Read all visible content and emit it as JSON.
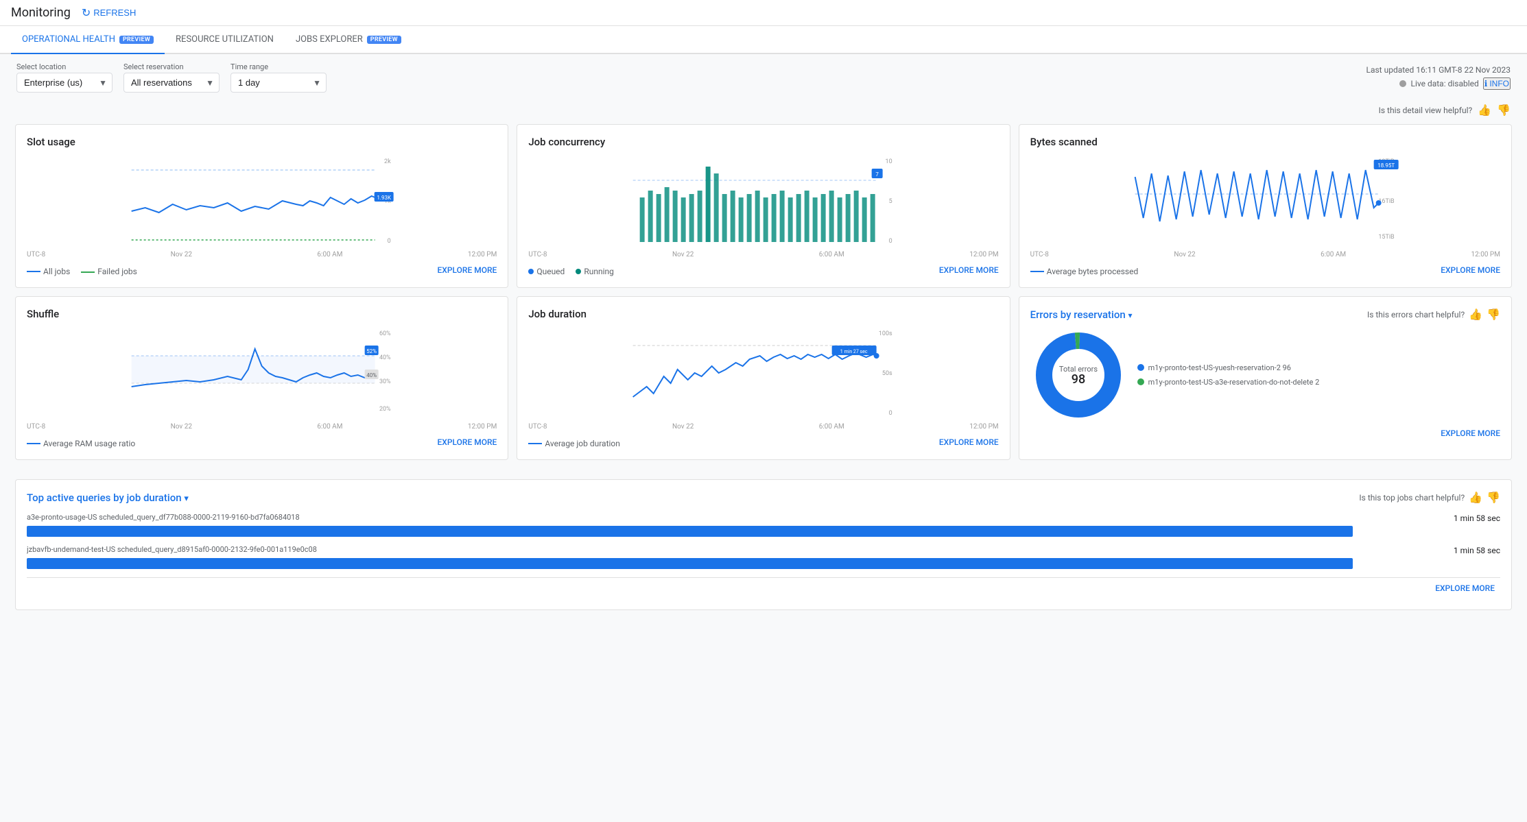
{
  "topBar": {
    "title": "Monitoring",
    "refreshLabel": "REFRESH"
  },
  "tabs": [
    {
      "id": "operational-health",
      "label": "OPERATIONAL HEALTH",
      "preview": true,
      "active": true
    },
    {
      "id": "resource-utilization",
      "label": "RESOURCE UTILIZATION",
      "preview": false,
      "active": false
    },
    {
      "id": "jobs-explorer",
      "label": "JOBS EXPLORER",
      "preview": true,
      "active": false
    }
  ],
  "controls": {
    "locationLabel": "Select location",
    "locationValue": "Enterprise (us)",
    "reservationLabel": "Select reservation",
    "reservationValue": "All reservations",
    "timeRangeLabel": "Time range",
    "timeRangeValue": "1 day"
  },
  "lastUpdated": {
    "text": "Last updated 16:11 GMT-8 22 Nov 2023",
    "liveLabel": "Live data: disabled",
    "infoLabel": "INFO"
  },
  "helpfulRow": {
    "text": "Is this detail view helpful?"
  },
  "charts": {
    "slotUsage": {
      "title": "Slot usage",
      "currentValue": "1.93K",
      "yMax": "2k",
      "yMid": "1k",
      "yMin": "0",
      "xLabels": [
        "UTC-8",
        "Nov 22",
        "6:00 AM",
        "12:00 PM"
      ],
      "legend": [
        {
          "label": "All jobs",
          "color": "#1a73e8",
          "type": "line"
        },
        {
          "label": "Failed jobs",
          "color": "#34a853",
          "type": "dashed"
        }
      ],
      "exploreLabel": "EXPLORE MORE"
    },
    "jobConcurrency": {
      "title": "Job concurrency",
      "currentValue": "7",
      "yMax": "10",
      "yMid": "5",
      "yMin": "0",
      "xLabels": [
        "UTC-8",
        "Nov 22",
        "6:00 AM",
        "12:00 PM"
      ],
      "legend": [
        {
          "label": "Queued",
          "color": "#1a73e8",
          "type": "dot"
        },
        {
          "label": "Running",
          "color": "#00897b",
          "type": "dot"
        }
      ],
      "exploreLabel": "EXPLORE MORE"
    },
    "bytesScanned": {
      "title": "Bytes scanned",
      "currentValue": "18.95T",
      "yMax": "18TiB",
      "yMid": "16TiB",
      "yMin": "15TiB",
      "xLabels": [
        "UTC-8",
        "Nov 22",
        "6:00 AM",
        "12:00 PM"
      ],
      "legend": [
        {
          "label": "Average bytes processed",
          "color": "#1a73e8",
          "type": "dashed"
        }
      ],
      "exploreLabel": "EXPLORE MORE"
    },
    "shuffle": {
      "title": "Shuffle",
      "currentValue": "52%",
      "yMax": "60%",
      "yMid2": "40%",
      "yMid": "30%",
      "yMin": "20%",
      "xLabels": [
        "UTC-8",
        "Nov 22",
        "6:00 AM",
        "12:00 PM"
      ],
      "legend": [
        {
          "label": "Average RAM usage ratio",
          "color": "#1a73e8",
          "type": "line"
        }
      ],
      "exploreLabel": "EXPLORE MORE"
    },
    "jobDuration": {
      "title": "Job duration",
      "currentValue": "1 min 27 sec",
      "yMax": "100s",
      "yMid": "50s",
      "yMin": "0",
      "xLabels": [
        "UTC-8",
        "Nov 22",
        "6:00 AM",
        "12:00 PM"
      ],
      "legend": [
        {
          "label": "Average job duration",
          "color": "#1a73e8",
          "type": "line"
        }
      ],
      "exploreLabel": "EXPLORE MORE"
    }
  },
  "errorsChart": {
    "title": "Errors by",
    "titleLink": "reservation",
    "helpfulText": "Is this errors chart helpful?",
    "totalLabel": "Total errors",
    "totalValue": "98",
    "legend": [
      {
        "label": "m1y-pronto-test-US-yuesh-reservation-2 96",
        "color": "#1a73e8"
      },
      {
        "label": "m1y-pronto-test-US-a3e-reservation-do-not-delete 2",
        "color": "#34a853"
      }
    ],
    "exploreLabel": "EXPLORE MORE",
    "donutData": [
      {
        "value": 96,
        "color": "#1a73e8"
      },
      {
        "value": 2,
        "color": "#34a853"
      }
    ]
  },
  "topQueries": {
    "title": "Top active queries by",
    "titleLink": "job duration",
    "helpfulText": "Is this top jobs chart helpful?",
    "queries": [
      {
        "text": "a3e-pronto-usage-US scheduled_query_df77b088-0000-2119-9160-bd7fa0684018",
        "time": "1 min 58 sec",
        "barWidth": "90%"
      },
      {
        "text": "jzbavfb-undemand-test-US scheduled_query_d8915af0-0000-2132-9fe0-001a119e0c08",
        "time": "1 min 58 sec",
        "barWidth": "90%"
      }
    ],
    "exploreLabel": "EXPLORE MORE"
  }
}
